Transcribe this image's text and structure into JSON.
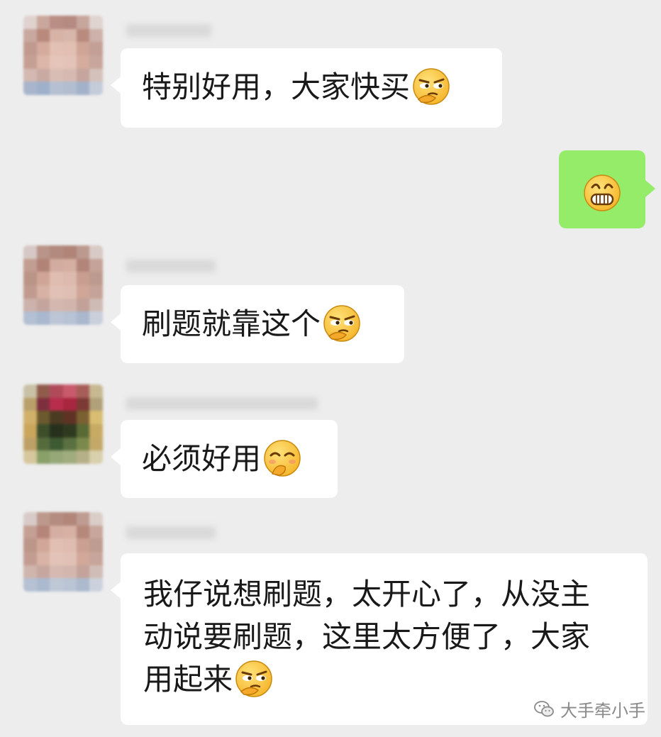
{
  "messages": [
    {
      "side": "left",
      "text": "特别好用，大家快买",
      "emoji": "smirk-emoji"
    },
    {
      "side": "right",
      "text": "",
      "emoji": "grin-emoji"
    },
    {
      "side": "left",
      "text": "刷题就靠这个",
      "emoji": "smirk-emoji"
    },
    {
      "side": "left",
      "text": "必须好用",
      "emoji": "chuckle-emoji"
    },
    {
      "side": "left",
      "lines": [
        "我仔说想刷题，太开心了，从没主",
        "动说要刷题，这里太方便了，大家",
        "用起来"
      ],
      "emoji": "smirk-emoji"
    }
  ],
  "watermark": {
    "text": "大手牵小手",
    "icon": "wechat-icon"
  },
  "colors": {
    "background": "#ededed",
    "bubble_left": "#ffffff",
    "bubble_right": "#95ec69",
    "text": "#191919"
  }
}
